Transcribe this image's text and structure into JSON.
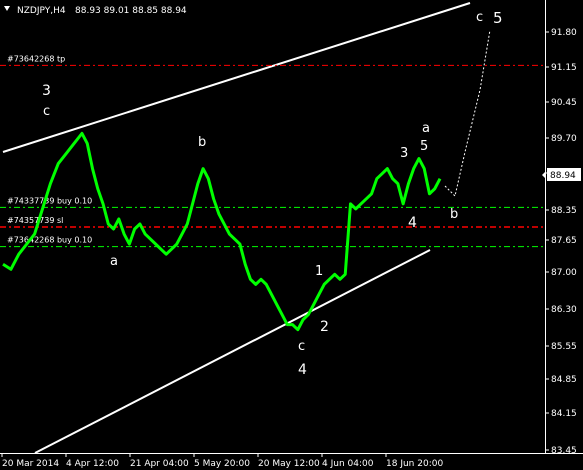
{
  "header": {
    "symbol": "NZDJPY,H4",
    "ohlc": "88.93 89.01 88.85 88.94"
  },
  "current_price": "88.94",
  "colors": {
    "price": "#00ff00",
    "order_tp": "#ff0000",
    "order_buy": "#00ff00",
    "order_sl": "#ff0000",
    "channel": "#ffffff",
    "text": "#ffffff",
    "axis": "#ffffff",
    "grid": "#808080"
  },
  "chart_data": {
    "type": "line",
    "ylim": [
      83.45,
      92.45
    ],
    "y_ticks": [
      "91.80",
      "91.15",
      "90.45",
      "89.70",
      "89.05",
      "88.35",
      "87.65",
      "87.00",
      "86.30",
      "85.55",
      "84.85",
      "84.15",
      "83.45"
    ],
    "x_ticks": [
      "20 Mar 2014",
      "4 Apr 12:00",
      "21 Apr 04:00",
      "5 May 20:00",
      "20 May 12:00",
      "4 Jun 04:00",
      "18 Jun 20:00"
    ],
    "series": [
      {
        "name": "NZDJPY",
        "points": [
          [
            0,
            87.2
          ],
          [
            3,
            87.1
          ],
          [
            6,
            87.4
          ],
          [
            9,
            87.6
          ],
          [
            12,
            87.8
          ],
          [
            15,
            88.3
          ],
          [
            18,
            88.8
          ],
          [
            21,
            89.2
          ],
          [
            24,
            89.4
          ],
          [
            27,
            89.6
          ],
          [
            30,
            89.8
          ],
          [
            32,
            89.6
          ],
          [
            34,
            89.1
          ],
          [
            36,
            88.7
          ],
          [
            38,
            88.4
          ],
          [
            40,
            88.0
          ],
          [
            42,
            87.9
          ],
          [
            44,
            88.1
          ],
          [
            46,
            87.8
          ],
          [
            48,
            87.6
          ],
          [
            50,
            87.9
          ],
          [
            52,
            88.0
          ],
          [
            54,
            87.8
          ],
          [
            56,
            87.7
          ],
          [
            58,
            87.6
          ],
          [
            60,
            87.5
          ],
          [
            62,
            87.4
          ],
          [
            64,
            87.5
          ],
          [
            66,
            87.6
          ],
          [
            68,
            87.8
          ],
          [
            70,
            88.0
          ],
          [
            72,
            88.4
          ],
          [
            74,
            88.8
          ],
          [
            76,
            89.1
          ],
          [
            78,
            88.9
          ],
          [
            80,
            88.5
          ],
          [
            82,
            88.2
          ],
          [
            84,
            88.0
          ],
          [
            86,
            87.8
          ],
          [
            88,
            87.7
          ],
          [
            90,
            87.6
          ],
          [
            92,
            87.2
          ],
          [
            94,
            86.9
          ],
          [
            96,
            86.8
          ],
          [
            98,
            86.9
          ],
          [
            100,
            86.8
          ],
          [
            102,
            86.6
          ],
          [
            104,
            86.4
          ],
          [
            106,
            86.2
          ],
          [
            108,
            86.0
          ],
          [
            110,
            86.0
          ],
          [
            112,
            85.9
          ],
          [
            114,
            86.1
          ],
          [
            116,
            86.2
          ],
          [
            118,
            86.4
          ],
          [
            120,
            86.6
          ],
          [
            122,
            86.8
          ],
          [
            124,
            86.9
          ],
          [
            126,
            87.0
          ],
          [
            128,
            86.9
          ],
          [
            130,
            87.0
          ],
          [
            132,
            88.4
          ],
          [
            134,
            88.3
          ],
          [
            136,
            88.4
          ],
          [
            138,
            88.5
          ],
          [
            140,
            88.6
          ],
          [
            142,
            88.9
          ],
          [
            144,
            89.0
          ],
          [
            146,
            89.1
          ],
          [
            148,
            88.9
          ],
          [
            150,
            88.8
          ],
          [
            152,
            88.4
          ],
          [
            154,
            88.8
          ],
          [
            156,
            89.1
          ],
          [
            158,
            89.3
          ],
          [
            160,
            89.1
          ],
          [
            162,
            88.6
          ],
          [
            164,
            88.7
          ],
          [
            166,
            88.9
          ]
        ]
      }
    ],
    "order_lines": [
      {
        "label": "#73642268 tp",
        "price": 91.15,
        "kind": "tp"
      },
      {
        "label": "#74337739 buy 0.10",
        "price": 88.33,
        "kind": "buy"
      },
      {
        "label": "#74357739 sl",
        "price": 87.94,
        "kind": "sl"
      },
      {
        "label": "#73642268 buy 0.10",
        "price": 87.55,
        "kind": "buy"
      }
    ],
    "wave_labels": [
      "3",
      "c",
      "b",
      "a",
      "1",
      "2",
      "c",
      "4",
      "3",
      "a",
      "5",
      "4",
      "b",
      "c",
      "5"
    ]
  }
}
